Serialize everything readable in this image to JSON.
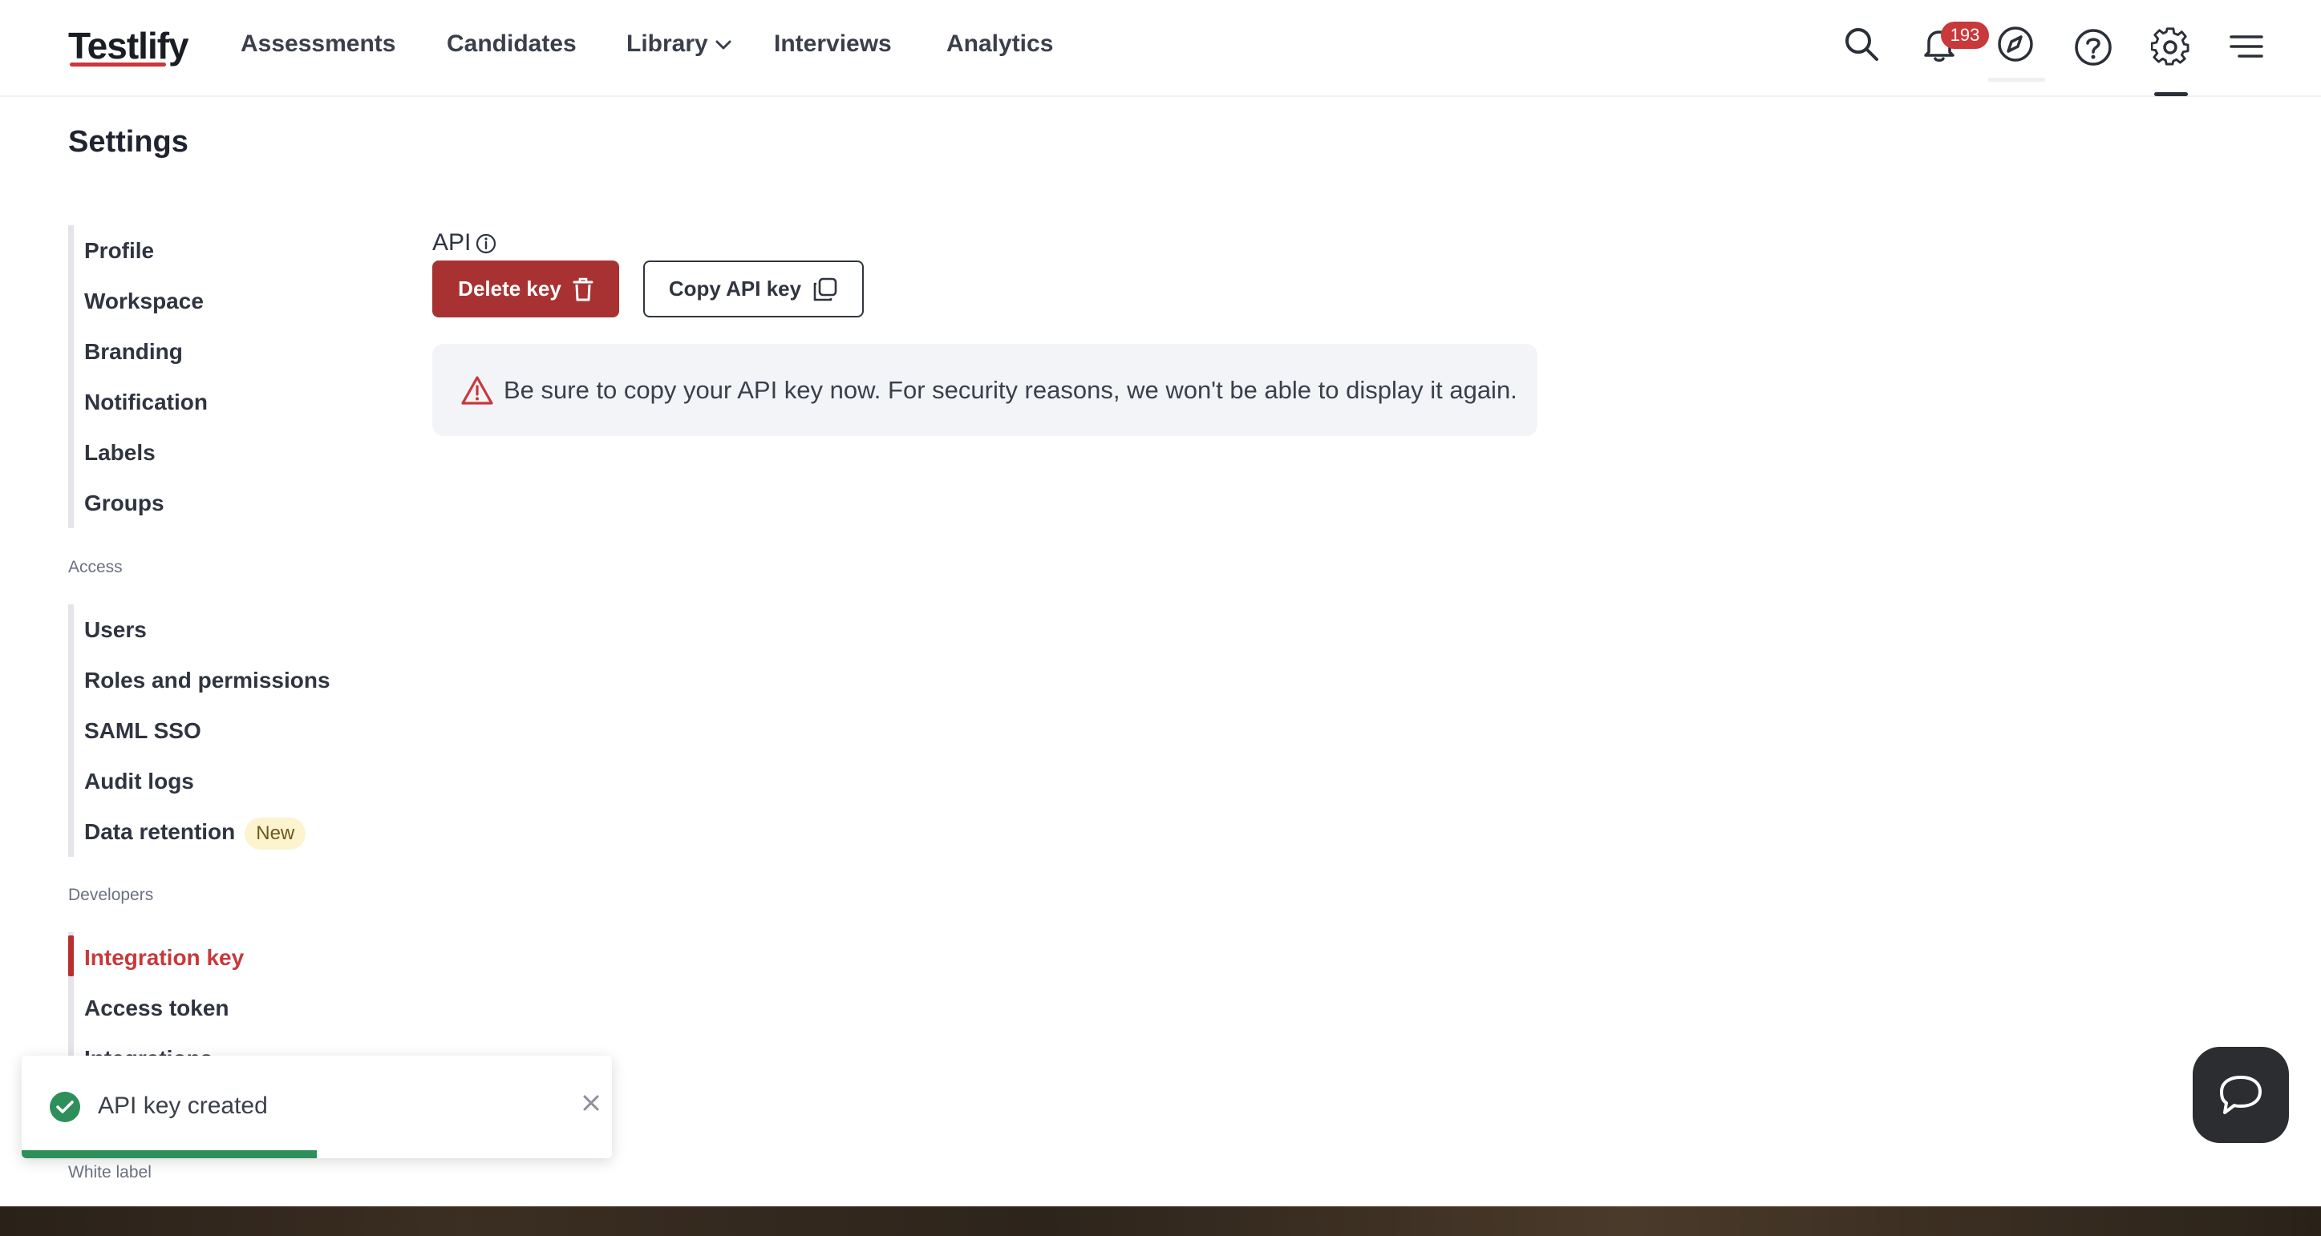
{
  "brand": {
    "name": "Testlify",
    "accent": "#c9383a"
  },
  "nav": {
    "assessments": "Assessments",
    "candidates": "Candidates",
    "library": "Library",
    "interviews": "Interviews",
    "analytics": "Analytics",
    "notification_count": "193",
    "icons": [
      "search-icon",
      "bell-icon",
      "compass-icon",
      "help-icon",
      "gear-icon",
      "menu-icon"
    ]
  },
  "page": {
    "title": "Settings"
  },
  "sidebar": {
    "general": [
      "Profile",
      "Workspace",
      "Branding",
      "Notification",
      "Labels",
      "Groups"
    ],
    "access_label": "Access",
    "access": [
      "Users",
      "Roles and permissions",
      "SAML SSO",
      "Audit logs",
      "Data retention"
    ],
    "new_tag": "New",
    "developers_label": "Developers",
    "developers": [
      "Integration key",
      "Access token",
      "Integrations"
    ],
    "active": "Integration key",
    "white_label": "White label"
  },
  "main": {
    "api_label": "API",
    "delete_button": "Delete key",
    "copy_button": "Copy API key",
    "warning": "Be sure to copy your API key now. For security reasons, we won't be able to display it again."
  },
  "toast": {
    "message": "API key created",
    "progress": 0.5
  }
}
